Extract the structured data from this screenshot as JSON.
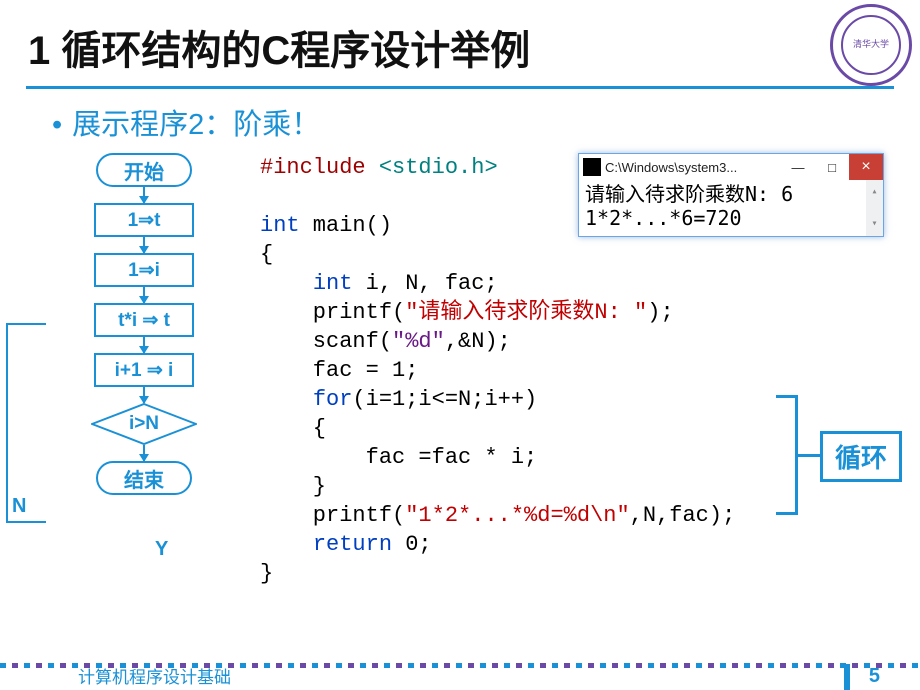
{
  "title": "1 循环结构的C程序设计举例",
  "bullet": "展示程序2：阶乘！",
  "flowchart": {
    "start": "开始",
    "p1": "1⇒t",
    "p2": "1⇒i",
    "p3": "t*i ⇒ t",
    "p4": "i+1 ⇒ i",
    "decision": "i>N",
    "no": "N",
    "yes": "Y",
    "end": "结束"
  },
  "code": {
    "l1_pp": "#include ",
    "l1_inc": "<stdio.h>",
    "l3_kw": "int",
    "l3_rest": " main()",
    "l4": "{",
    "l5_sp": "    ",
    "l5_kw": "int",
    "l5_rest": " i, N, fac;",
    "l6_sp": "    printf(",
    "l6_str": "\"请输入待求阶乘数N: \"",
    "l6_end": ");",
    "l7_sp": "    scanf(",
    "l7_fmt": "\"%d\"",
    "l7_end": ",&N);",
    "l8": "    fac = 1;",
    "l9_sp": "    ",
    "l9_kw": "for",
    "l9_rest": "(i=1;i<=N;i++)",
    "l10": "    {",
    "l11": "        fac =fac * i;",
    "l12": "    }",
    "l13_sp": "    printf(",
    "l13_str": "\"1*2*...*%d=%d\\n\"",
    "l13_end": ",N,fac);",
    "l14_sp": "    ",
    "l14_kw": "return",
    "l14_rest": " 0;",
    "l15": "}"
  },
  "loop_label": "循环",
  "window": {
    "title": "C:\\Windows\\system3...",
    "min": "—",
    "max": "□",
    "close": "×",
    "line1": "请输入待求阶乘数N: 6",
    "line2": "1*2*...*6=720"
  },
  "footer": "计算机程序设计基础",
  "page": "5",
  "seal": "清华大学"
}
